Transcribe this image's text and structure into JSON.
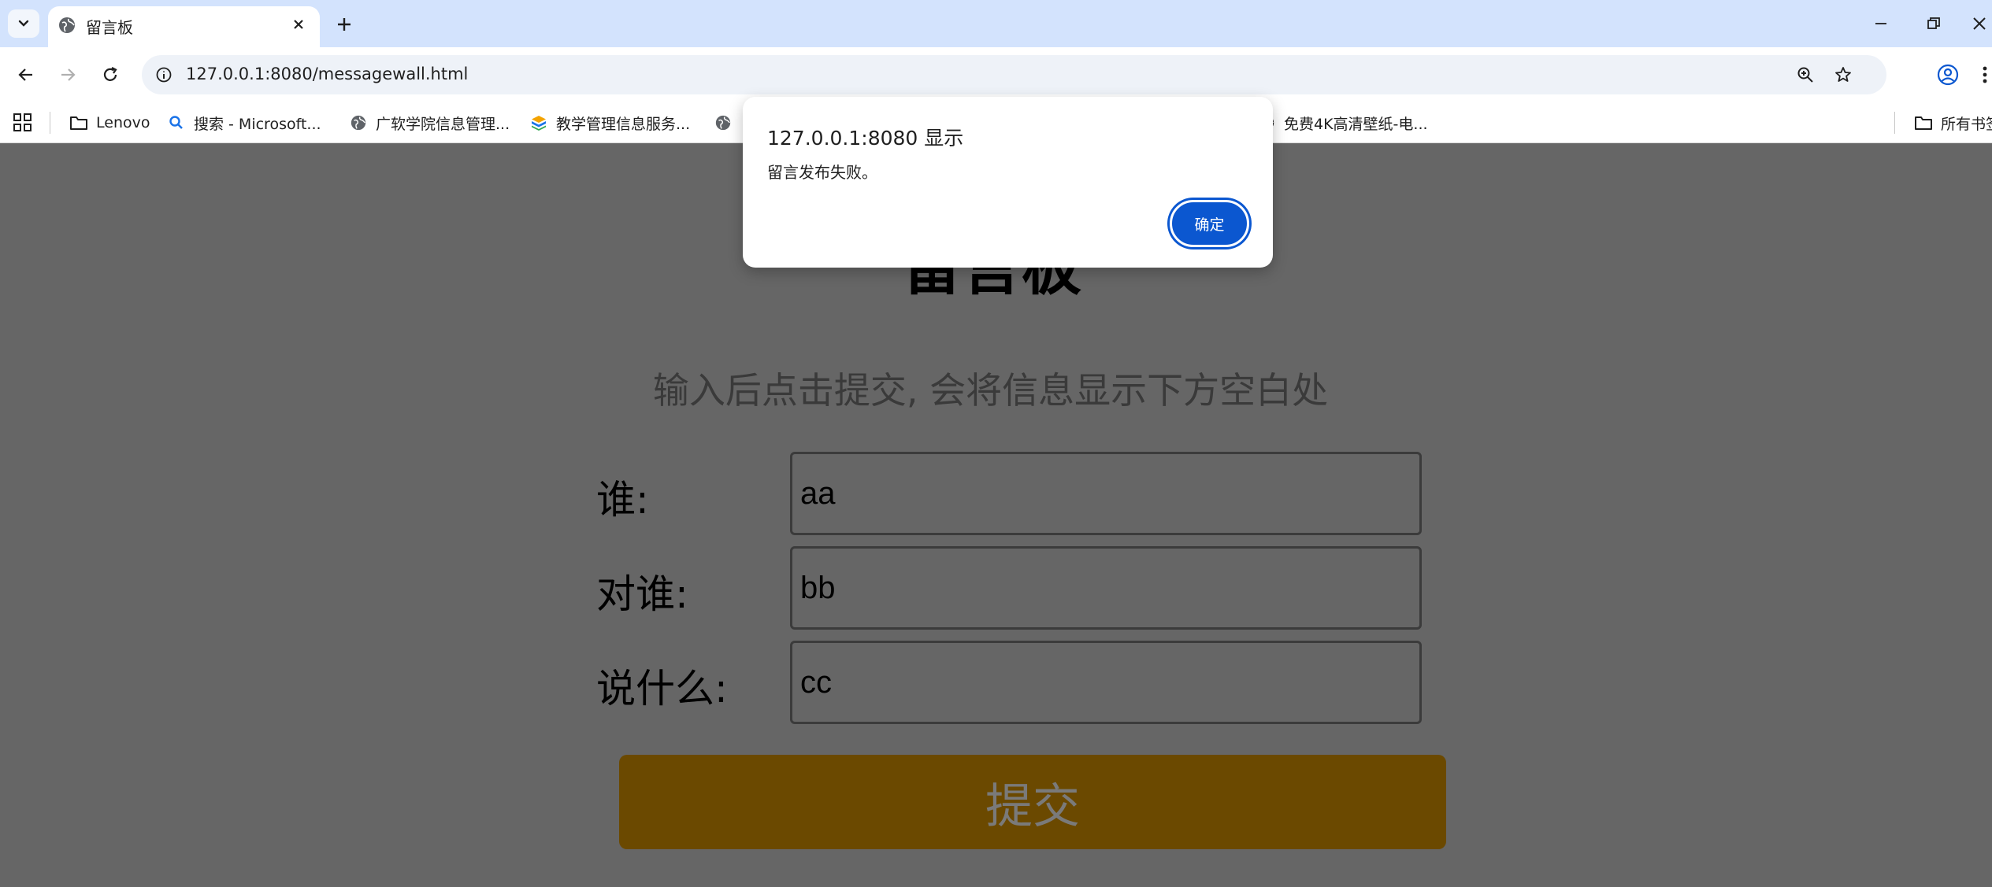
{
  "browser": {
    "tab_title": "留言板",
    "url": "127.0.0.1:8080/messagewall.html",
    "bookmarks": [
      {
        "label": "Lenovo",
        "icon": "folder-icon"
      },
      {
        "label": "搜索 - Microsoft...",
        "icon": "search-icon"
      },
      {
        "label": "广软学院信息管理...",
        "icon": "globe-icon"
      },
      {
        "label": "教学管理信息服务...",
        "icon": "app-icon"
      },
      {
        "label": "免费4K高清壁纸-电...",
        "icon": "globe-icon"
      },
      {
        "label": "所有书签",
        "icon": "folder-icon"
      }
    ]
  },
  "page": {
    "heading": "留言板",
    "subtitle": "输入后点击提交, 会将信息显示下方空白处",
    "fields": [
      {
        "label": "谁:",
        "value": "aa"
      },
      {
        "label": "对谁:",
        "value": "bb"
      },
      {
        "label": "说什么:",
        "value": "cc"
      }
    ],
    "submit_label": "提交"
  },
  "dialog": {
    "title": "127.0.0.1:8080 显示",
    "message": "留言发布失败。",
    "ok_label": "确定"
  },
  "colors": {
    "overlay": "#666666",
    "submit_button": "#6b4900",
    "dialog_button": "#0b57d0",
    "tab_strip": "#d3e3fd"
  }
}
